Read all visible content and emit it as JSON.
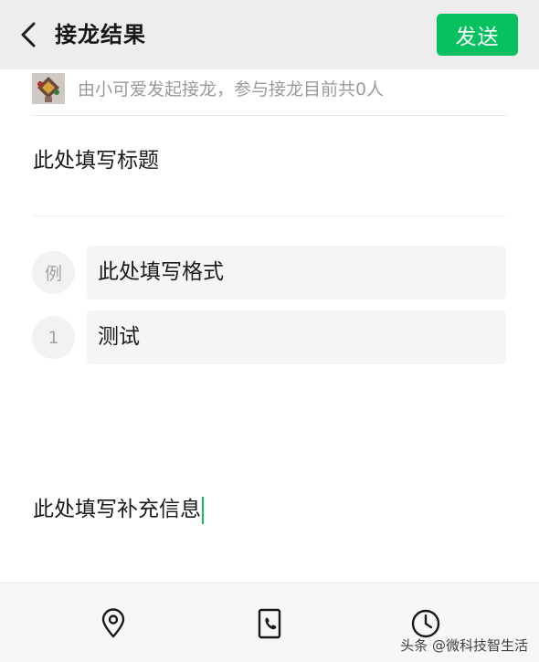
{
  "header": {
    "back_icon": "chevron-left-icon",
    "title": "接龙结果",
    "send_label": "发送",
    "send_color": "#07c160"
  },
  "initiator": {
    "avatar_icon": "avatar-image",
    "text": "由小可爱发起接龙，参与接龙目前共0人"
  },
  "form": {
    "title_text": "此处填写标题",
    "entries": [
      {
        "marker": "例",
        "text": "此处填写格式"
      },
      {
        "marker": "1",
        "text": "测试"
      }
    ],
    "extra_info_text": "此处填写补充信息"
  },
  "toolbar": {
    "tools": [
      {
        "icon": "location-pin-icon"
      },
      {
        "icon": "phone-icon"
      },
      {
        "icon": "clock-icon"
      }
    ]
  },
  "watermark": {
    "text": "头条 @微科技智生活"
  }
}
